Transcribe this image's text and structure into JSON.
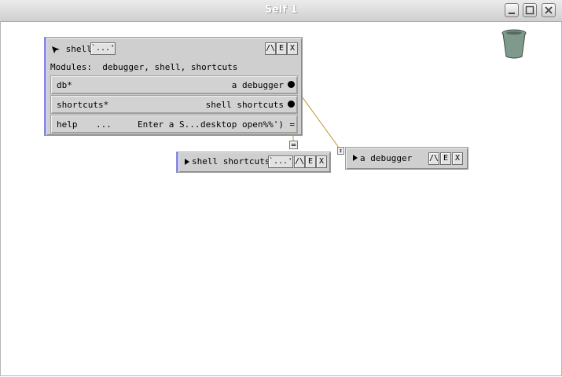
{
  "window": {
    "title": "Self 1"
  },
  "shell": {
    "title": "shell",
    "edit_button": "`...'",
    "ctrl_buttons": [
      "/\\",
      "E",
      "X"
    ],
    "modules_label": "Modules:",
    "modules_value": "debugger, shell, shortcuts",
    "slots": [
      {
        "name": "db*",
        "value": "a debugger"
      },
      {
        "name": "shortcuts*",
        "value": "shell shortcuts"
      },
      {
        "name": "help",
        "dots": "...",
        "expr": "Enter a S...",
        "value": "desktop open%%')"
      }
    ]
  },
  "shell_shortcuts": {
    "title": "shell shortcuts",
    "edit_button": "`...'",
    "ctrl_buttons": [
      "/\\",
      "E",
      "X"
    ]
  },
  "debugger": {
    "title": "a debugger",
    "ctrl_buttons": [
      "/\\",
      "E",
      "X"
    ]
  },
  "colors": {
    "wire": "#b8962c",
    "outliner_bg": "#cfcfcf",
    "accent_blue": "#8d8de0"
  }
}
